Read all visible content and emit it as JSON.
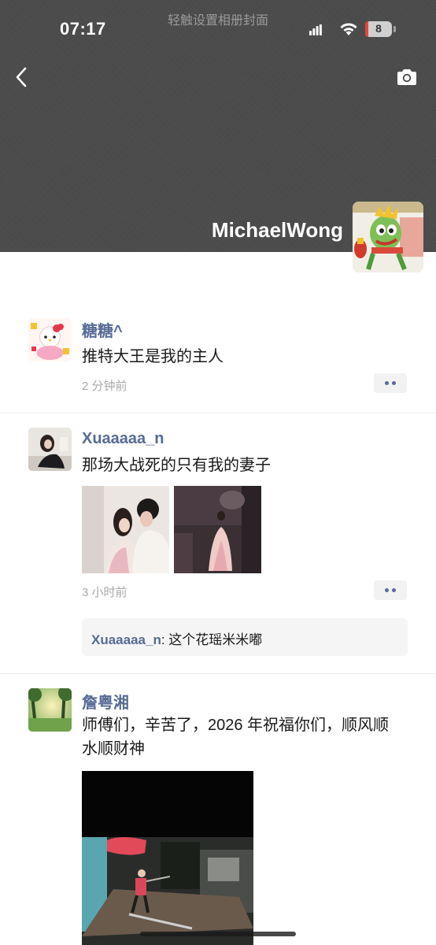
{
  "status_bar": {
    "time": "07:17",
    "battery": "8",
    "battery_color": "#e8453c"
  },
  "cover": {
    "hint": "轻触设置相册封面",
    "username": "MichaelWong"
  },
  "icons": {
    "back": "chevron-left-icon",
    "camera": "camera-icon",
    "signal": "signal-icon",
    "wifi": "wifi-icon",
    "battery": "battery-icon"
  },
  "colors": {
    "nickname": "#576b95",
    "cover_bg": "#4a4a4a"
  },
  "posts": [
    {
      "nickname": "糖糖^",
      "text": "推特大王是我的主人",
      "time": "2 分钟前"
    },
    {
      "nickname": "Xuaaaaa_n",
      "text": "那场大战死的只有我的妻子",
      "time": "3 小时前",
      "comment": {
        "author": "Xuaaaaa_n",
        "separator": ": ",
        "text": "这个花瑶米米嘟"
      }
    },
    {
      "nickname": "詹粤湘",
      "text": "师傅们，辛苦了，2026 年祝福你们，顺风顺水顺财神"
    }
  ]
}
